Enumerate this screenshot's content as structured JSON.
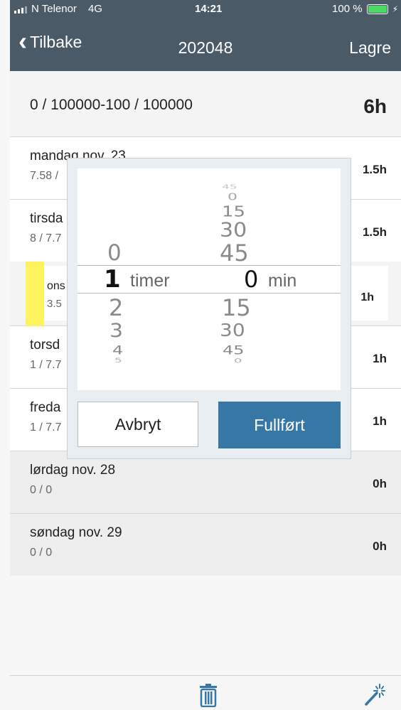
{
  "status": {
    "carrier": "N Telenor",
    "network": "4G",
    "time": "14:21",
    "battery": "100 %"
  },
  "nav": {
    "back": "Tilbake",
    "title": "202048",
    "save": "Lagre"
  },
  "summary": {
    "range": "0 / 100000-100 / 100000",
    "total": "6h"
  },
  "days": [
    {
      "day": "mandag nov. 23",
      "sub": "7.58 /",
      "hours": "1.5h"
    },
    {
      "day": "tirsda",
      "sub": "8 / 7.7",
      "hours": "1.5h"
    },
    {
      "day": "ons",
      "sub": "3.5",
      "hours": "1h"
    },
    {
      "day": "torsd",
      "sub": "1 / 7.7",
      "hours": "1h"
    },
    {
      "day": "freda",
      "sub": "1 / 7.7",
      "hours": "1h"
    },
    {
      "day": "lørdag nov. 28",
      "sub": "0 / 0",
      "hours": "0h"
    },
    {
      "day": "søndag nov. 29",
      "sub": "0 / 0",
      "hours": "0h"
    }
  ],
  "picker": {
    "hours_above": [
      "0"
    ],
    "hours_selected": "1",
    "hours_below": [
      "2",
      "3",
      "4",
      "5"
    ],
    "hours_unit": "timer",
    "minutes_above": [
      "45",
      "0",
      "15",
      "30",
      "45"
    ],
    "minutes_selected": "0",
    "minutes_below": [
      "15",
      "30",
      "45",
      "0"
    ],
    "minutes_unit": "min",
    "cancel": "Avbryt",
    "done": "Fullført"
  },
  "colors": {
    "navbar": "#4a5a67",
    "done_button": "#3777a5",
    "highlight": "#fff34d"
  },
  "icons": {
    "trash": "trash-icon",
    "magic_wand": "magic-wand-icon",
    "back": "chevron-left-icon"
  }
}
